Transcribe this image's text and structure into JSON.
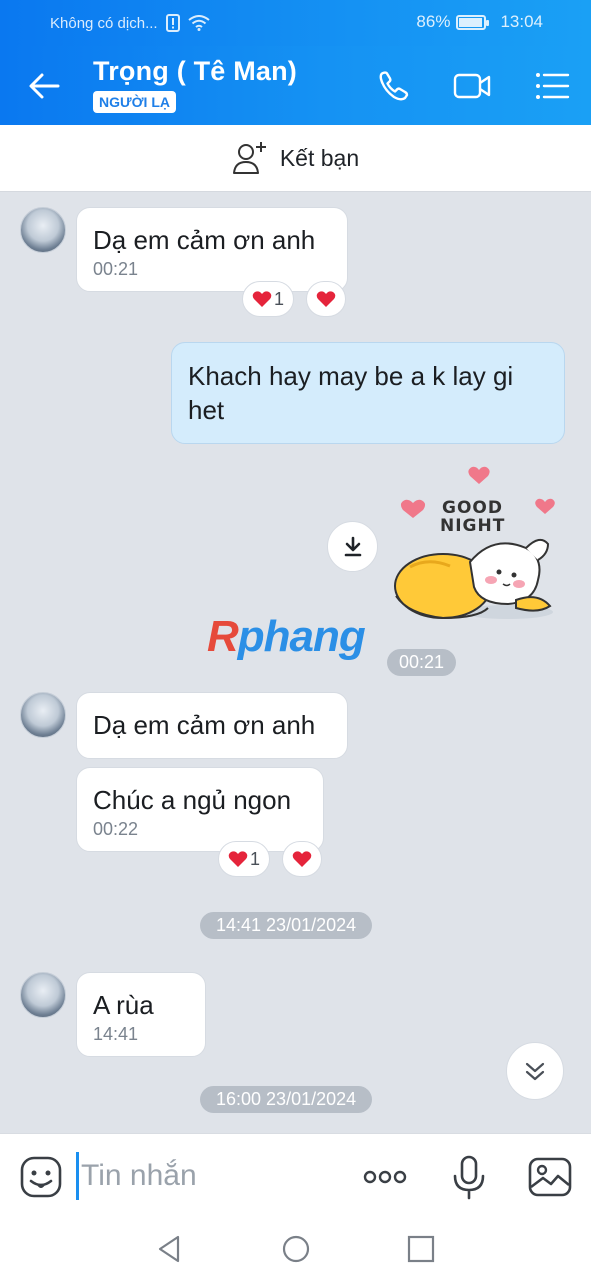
{
  "status": {
    "carrier": "Không có dịch...",
    "battery": "86%",
    "battery_level": 0.86,
    "time": "13:04"
  },
  "header": {
    "name": "Trọng ( Tê Man)",
    "badge": "NGƯỜI LẠ",
    "icons": [
      "back-arrow-icon",
      "phone-icon",
      "video-call-icon",
      "menu-list-icon"
    ]
  },
  "friend_bar": {
    "label": "Kết bạn",
    "icon": "add-friend-icon"
  },
  "messages": [
    {
      "text": "Dạ em cảm ơn anh",
      "time": "00:21",
      "reaction_count": "1"
    },
    {
      "text": "Khach hay may be a k lay gi het"
    },
    {
      "sticker_text": "GOOD NIGHT",
      "time": "00:21"
    },
    {
      "text": "Dạ em cảm ơn anh"
    },
    {
      "text": "Chúc a ngủ ngon",
      "time": "00:22",
      "reaction_count": "1"
    },
    {
      "text": "A rùa",
      "time": "14:41"
    }
  ],
  "dividers": [
    "14:41 23/01/2024",
    "16:00 23/01/2024"
  ],
  "watermark": {
    "first": "R",
    "rest": "phang"
  },
  "input": {
    "placeholder": "Tin nhắn"
  },
  "colors": {
    "accent": "#1592f3",
    "mine_bubble": "#d4ecfc",
    "heart": "#e5243b"
  }
}
